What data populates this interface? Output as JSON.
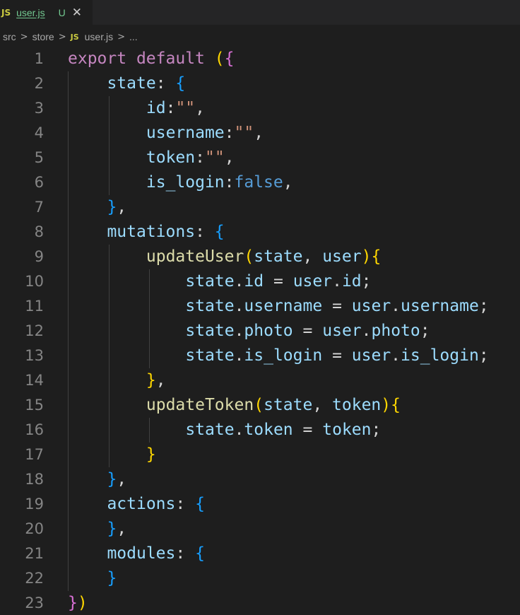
{
  "tab": {
    "language_badge": "JS",
    "file_name": "user.js",
    "status": "U",
    "close_glyph": "✕"
  },
  "breadcrumb": {
    "parts": [
      "src",
      "store",
      "user.js",
      "..."
    ],
    "separator": ">",
    "language_badge": "JS"
  },
  "editor": {
    "line_numbers": [
      "1",
      "2",
      "3",
      "4",
      "5",
      "6",
      "7",
      "8",
      "9",
      "10",
      "11",
      "12",
      "13",
      "14",
      "15",
      "16",
      "17",
      "18",
      "19",
      "20",
      "21",
      "22",
      "23"
    ],
    "lines": [
      "export default ({",
      "    state: {",
      "        id:\"\",",
      "        username:\"\",",
      "        token:\"\",",
      "        is_login:false,",
      "    },",
      "    mutations: {",
      "        updateUser(state, user){",
      "            state.id = user.id;",
      "            state.username = user.username;",
      "            state.photo = user.photo;",
      "            state.is_login = user.is_login;",
      "        },",
      "        updateToken(state, token){",
      "            state.token = token;",
      "        }",
      "    },",
      "    actions: {",
      "    },",
      "    modules: {",
      "    }",
      "})"
    ]
  },
  "colors": {
    "background": "#1e1e1e",
    "tabbar": "#252526",
    "keyword": "#c586c0",
    "boolean": "#569cd6",
    "property": "#9cdcfe",
    "function": "#dcdcaa",
    "string": "#ce9178",
    "bracket_level1": "#ffd700",
    "bracket_level2": "#da70d6",
    "bracket_level3": "#179fff",
    "line_number": "#858585",
    "git_untracked": "#73c991"
  }
}
